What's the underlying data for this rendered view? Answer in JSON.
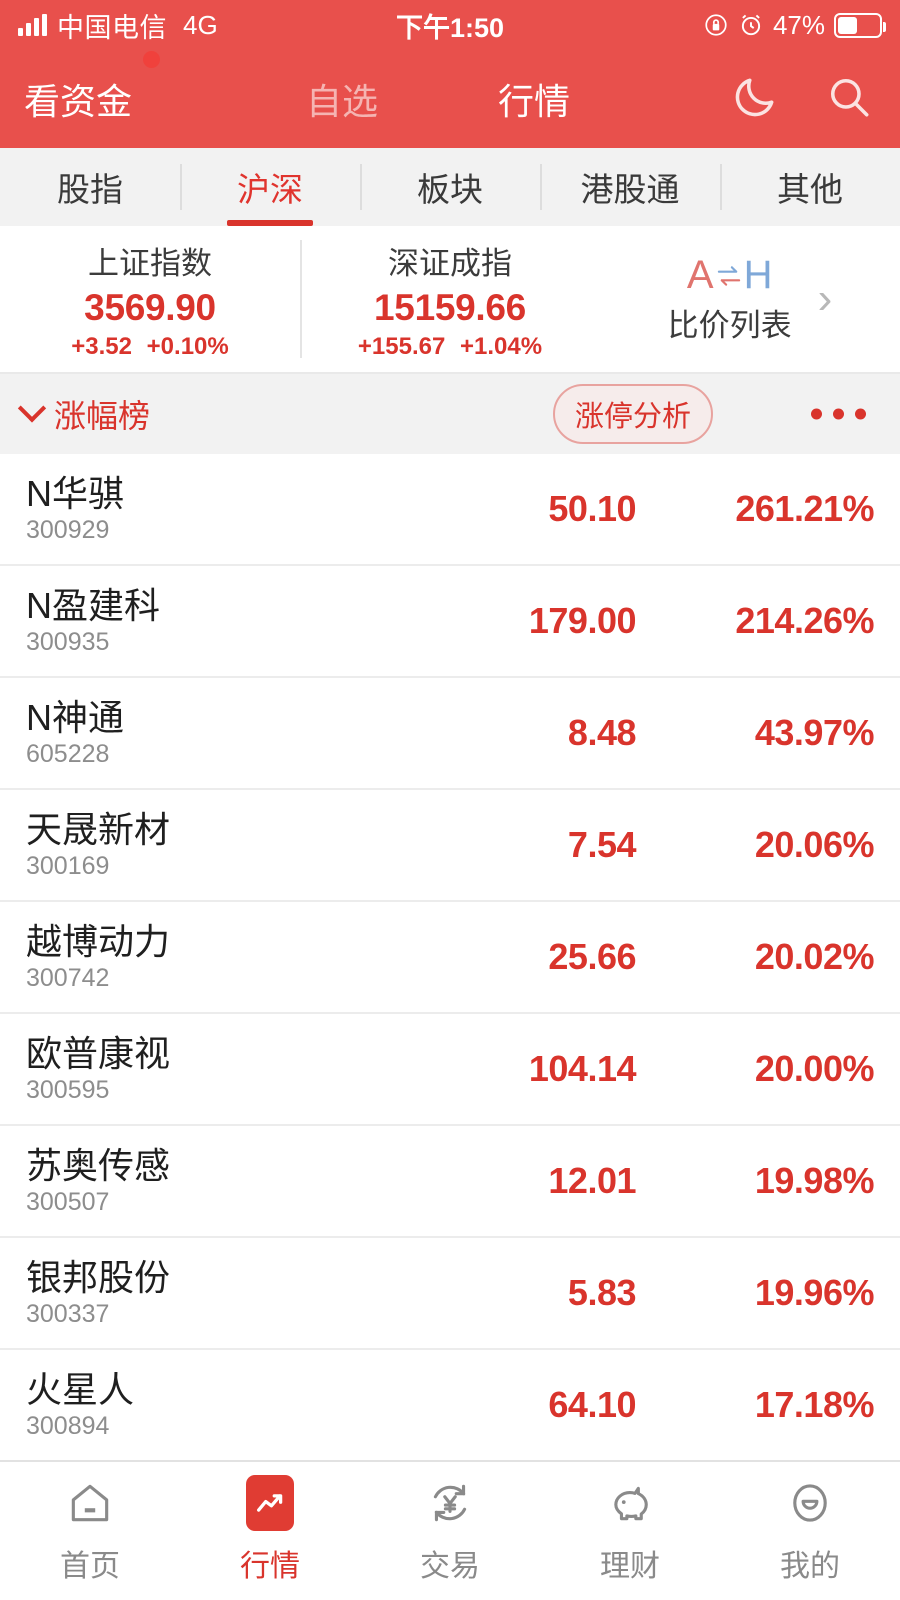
{
  "statusbar": {
    "carrier": "中国电信",
    "network": "4G",
    "time": "下午1:50",
    "battery_pct": "47%",
    "rotation_lock_icon": "rotation-lock-icon",
    "alarm_icon": "alarm-icon"
  },
  "header": {
    "money_tab": "看资金",
    "watchlist_tab": "自选",
    "market_tab": "行情",
    "moon_icon": "moon-icon",
    "search_icon": "search-icon",
    "accent": "#e8504c"
  },
  "subtabs": [
    {
      "label": "股指",
      "active": false
    },
    {
      "label": "沪深",
      "active": true
    },
    {
      "label": "板块",
      "active": false
    },
    {
      "label": "港股通",
      "active": false
    },
    {
      "label": "其他",
      "active": false
    }
  ],
  "indices": [
    {
      "name": "上证指数",
      "value": "3569.90",
      "change": "+3.52",
      "change_pct": "+0.10%"
    },
    {
      "name": "深证成指",
      "value": "15159.66",
      "change": "+155.67",
      "change_pct": "+1.04%"
    }
  ],
  "ah_card": {
    "logo_a": "A",
    "logo_h": "H",
    "label": "比价列表",
    "chevron_icon": "chevron-right-icon",
    "color_a": "#e0746e",
    "color_h": "#7fa8d8"
  },
  "rank_toolbar": {
    "title": "涨幅榜",
    "chevron_icon": "chevron-down-icon",
    "pill_label": "涨停分析",
    "more_icon": "more-dots-icon"
  },
  "stocks": [
    {
      "name": "N华骐",
      "code": "300929",
      "price": "50.10",
      "change_pct": "261.21%"
    },
    {
      "name": "N盈建科",
      "code": "300935",
      "price": "179.00",
      "change_pct": "214.26%"
    },
    {
      "name": "N神通",
      "code": "605228",
      "price": "8.48",
      "change_pct": "43.97%"
    },
    {
      "name": "天晟新材",
      "code": "300169",
      "price": "7.54",
      "change_pct": "20.06%"
    },
    {
      "name": "越博动力",
      "code": "300742",
      "price": "25.66",
      "change_pct": "20.02%"
    },
    {
      "name": "欧普康视",
      "code": "300595",
      "price": "104.14",
      "change_pct": "20.00%"
    },
    {
      "name": "苏奥传感",
      "code": "300507",
      "price": "12.01",
      "change_pct": "19.98%"
    },
    {
      "name": "银邦股份",
      "code": "300337",
      "price": "5.83",
      "change_pct": "19.96%"
    },
    {
      "name": "火星人",
      "code": "300894",
      "price": "64.10",
      "change_pct": "17.18%"
    }
  ],
  "bottomnav": [
    {
      "label": "首页",
      "icon": "home-icon",
      "active": false
    },
    {
      "label": "行情",
      "icon": "market-icon",
      "active": true
    },
    {
      "label": "交易",
      "icon": "trade-yuan-icon",
      "active": false
    },
    {
      "label": "理财",
      "icon": "piggy-bank-icon",
      "active": false
    },
    {
      "label": "我的",
      "icon": "profile-icon",
      "active": false
    }
  ],
  "colors": {
    "up_red": "#d9342c",
    "header_red": "#e8504c",
    "muted_gray": "#8d8d8d"
  }
}
